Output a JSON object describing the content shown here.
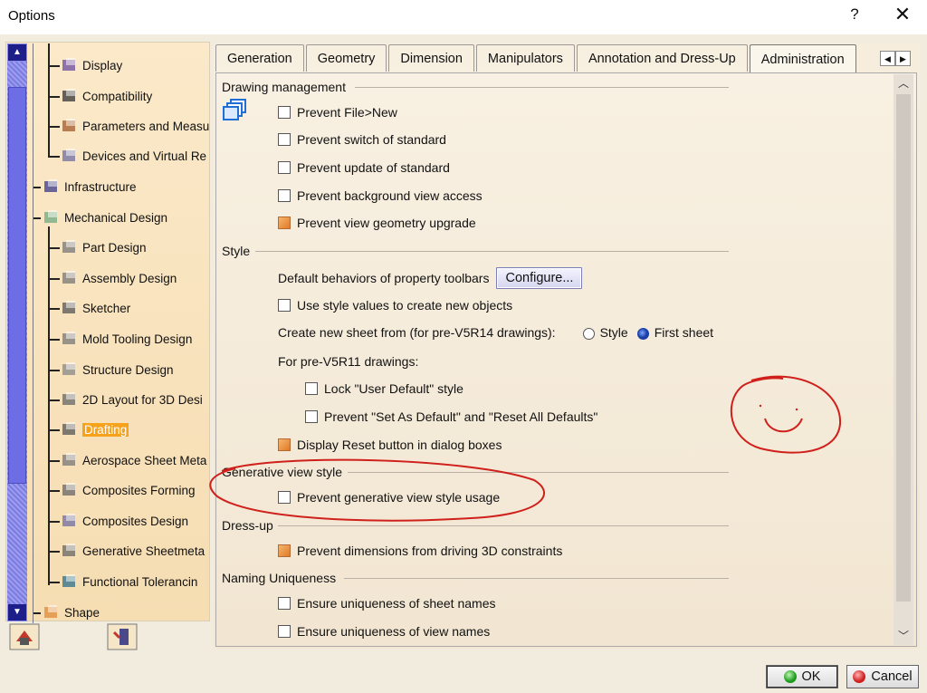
{
  "window": {
    "title": "Options",
    "help_label": "?",
    "close_label": "✕"
  },
  "tree": {
    "items": [
      {
        "label": "Display",
        "icon": "display-icon"
      },
      {
        "label": "Compatibility",
        "icon": "compatibility-icon"
      },
      {
        "label": "Parameters and Measu",
        "icon": "parameters-icon"
      },
      {
        "label": "Devices and Virtual Re",
        "icon": "devices-icon"
      },
      {
        "label": "Infrastructure",
        "icon": "infrastructure-icon"
      },
      {
        "label": "Mechanical Design",
        "icon": "mechanical-design-icon"
      },
      {
        "label": "Part Design",
        "icon": "part-design-icon"
      },
      {
        "label": "Assembly Design",
        "icon": "assembly-design-icon"
      },
      {
        "label": "Sketcher",
        "icon": "sketcher-icon"
      },
      {
        "label": "Mold Tooling Design",
        "icon": "mold-tooling-icon"
      },
      {
        "label": "Structure Design",
        "icon": "structure-design-icon"
      },
      {
        "label": "2D Layout for 3D Desi",
        "icon": "layout-icon"
      },
      {
        "label": "Drafting",
        "icon": "drafting-icon"
      },
      {
        "label": "Aerospace Sheet Meta",
        "icon": "aerospace-sheet-icon"
      },
      {
        "label": "Composites Forming",
        "icon": "composites-forming-icon"
      },
      {
        "label": "Composites Design",
        "icon": "composites-design-icon"
      },
      {
        "label": "Generative Sheetmeta",
        "icon": "generative-sheetmetal-icon"
      },
      {
        "label": "Functional Tolerancin",
        "icon": "functional-tolerancing-icon"
      },
      {
        "label": "Shape",
        "icon": "shape-icon"
      }
    ],
    "selected": "Drafting"
  },
  "tabs": [
    {
      "label": "Generation"
    },
    {
      "label": "Geometry"
    },
    {
      "label": "Dimension"
    },
    {
      "label": "Manipulators"
    },
    {
      "label": "Annotation and Dress-Up"
    },
    {
      "label": "Administration"
    }
  ],
  "active_tab": "Administration",
  "drawing_management": {
    "title": "Drawing management",
    "options": [
      {
        "label": "Prevent File>New",
        "checked": false
      },
      {
        "label": "Prevent switch of standard",
        "checked": false
      },
      {
        "label": "Prevent update of standard",
        "checked": false
      },
      {
        "label": "Prevent background view access",
        "checked": false
      },
      {
        "label": "Prevent view geometry upgrade",
        "checked": true
      }
    ]
  },
  "style": {
    "title": "Style",
    "toolbar_label": "Default behaviors of property toolbars",
    "configure_label": "Configure...",
    "use_style_label": "Use style values to create new objects",
    "use_style_checked": false,
    "create_sheet_label": "Create new sheet from (for pre-V5R14 drawings):",
    "radio_style_label": "Style",
    "radio_first_label": "First sheet",
    "radio_selected": "First sheet",
    "pre_v5r11_label": "For pre-V5R11 drawings:",
    "lock_label": "Lock \"User Default\" style",
    "lock_checked": false,
    "prevent_set_label": "Prevent \"Set As Default\" and \"Reset All Defaults\"",
    "prevent_set_checked": false,
    "display_reset_label": "Display Reset button in dialog boxes",
    "display_reset_checked": true
  },
  "generative": {
    "title": "Generative view style",
    "option_label": "Prevent generative view style usage",
    "option_checked": false
  },
  "dressup": {
    "title": "Dress-up",
    "option_label": "Prevent dimensions from driving 3D constraints",
    "option_checked": true
  },
  "naming": {
    "title": "Naming Uniqueness",
    "sheet_label": "Ensure uniqueness of sheet names",
    "view_label": "Ensure uniqueness of view names"
  },
  "buttons": {
    "ok_label": "OK",
    "cancel_label": "Cancel"
  },
  "colors": {
    "selection": "#f7a21b",
    "annotation": "#d0201c",
    "scroll": "#6d6de6"
  }
}
